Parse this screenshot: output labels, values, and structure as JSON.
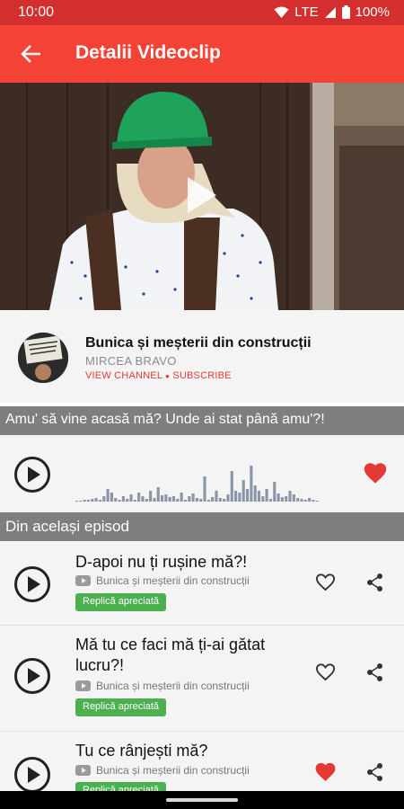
{
  "status": {
    "time": "10:00",
    "network": "LTE",
    "battery": "100%"
  },
  "appbar": {
    "title": "Detalii Videoclip"
  },
  "video": {
    "title": "Bunica și meșterii din construcții",
    "channel": "MIRCEA BRAVO",
    "view_channel": "VIEW CHANNEL",
    "separator": "●",
    "subscribe": "SUBSCRIBE"
  },
  "current_quote": {
    "text": "Amu' să vine acasă mă? Unde ai stat până amu'?!",
    "liked": true
  },
  "section": {
    "title": "Din același episod"
  },
  "items": [
    {
      "title": "D-apoi nu ți rușine mă?!",
      "source": "Bunica și meșterii din construcții",
      "badge": "Replică apreciată",
      "liked": false
    },
    {
      "title": "Mă tu ce faci mă ți-ai gătat lucru?!",
      "source": "Bunica și meșterii din construcții",
      "badge": "Replică apreciată",
      "liked": false
    },
    {
      "title": "Tu ce rânjești mă?",
      "source": "Bunica și meșterii din construcții",
      "badge": "Replică apreciată",
      "liked": true
    }
  ],
  "colors": {
    "primary": "#f44336",
    "status": "#d32f2f",
    "accent": "#e53935",
    "badge": "#4caf50",
    "section": "#7e7e7e"
  }
}
